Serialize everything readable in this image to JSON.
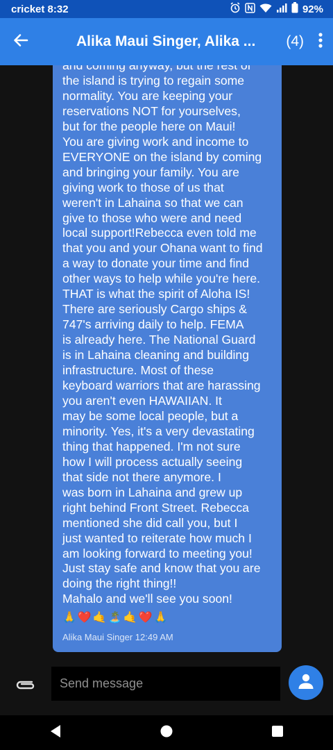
{
  "status_bar": {
    "carrier": "cricket",
    "time": "8:32",
    "battery": "92%",
    "icons": [
      "alarm-icon",
      "nfc-icon",
      "wifi-icon",
      "signal-icon",
      "battery-icon"
    ]
  },
  "app_bar": {
    "title": "Alika Maui Singer, Alika ...",
    "participant_count": "(4)",
    "back_icon": "arrow-left-icon",
    "more_icon": "more-vertical-icon"
  },
  "message": {
    "text": "and coming anyway, but the rest of\nthe island is trying to regain some\nnormality. You are keeping your\nreservations NOT for yourselves,\nbut for the people here on Maui!\nYou are giving work and income to\nEVERYONE on the island by coming\nand bringing your family. You are\ngiving work to those of us that\nweren't in Lahaina so that we can\ngive to those who were and need\nlocal support!Rebecca even told me\nthat you and your Ohana want to find\na way to donate your time and find\nother ways to help while you're here.\nTHAT is what the spirit of Aloha IS!\nThere are seriously Cargo ships &\n747's arriving daily to help. FEMA\nis already here. The National Guard\nis in Lahaina cleaning and building\ninfrastructure. Most of these\nkeyboard warriors that are harassing\nyou aren't even HAWAIIAN. It\nmay be some local people, but a\nminority. Yes, it's a very devastating\nthing that happened. I'm not sure\nhow I will process actually seeing\nthat side not there anymore. I\nwas born in Lahaina and grew up\nright behind Front Street. Rebecca\nmentioned she did call you, but I\njust wanted to reiterate how much I\nam looking forward to meeting you!\nJust stay safe and know that you are\ndoing the right thing!!\nMahalo and we'll see you soon!",
    "emojis": [
      "🙏",
      "❤️",
      "🤙",
      "🏝️",
      "🤙",
      "❤️",
      "🙏"
    ],
    "sender": "Alika Maui Singer",
    "timestamp": "12:49 AM",
    "bubble_color": "#4a80d8"
  },
  "composer": {
    "placeholder": "Send message",
    "attach_icon": "paperclip-icon",
    "avatar_icon": "person-icon"
  },
  "nav_bar": {
    "buttons": [
      "back-triangle-icon",
      "home-circle-icon",
      "recents-square-icon"
    ]
  },
  "colors": {
    "status_bar": "#0f52b8",
    "app_bar": "#2f80e6",
    "background": "#121212"
  }
}
